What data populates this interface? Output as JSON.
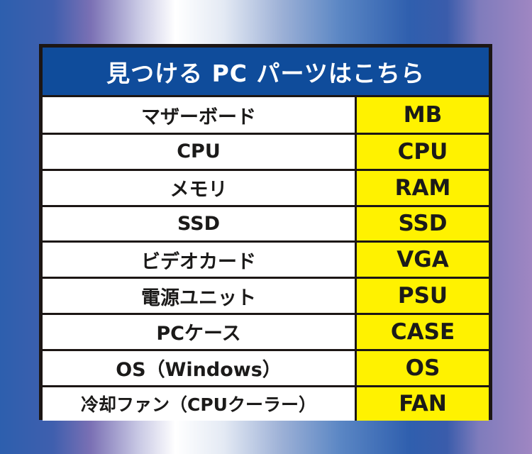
{
  "title": "見つける PC パーツはこちら",
  "colors": {
    "header_bg": "#0f4c9b",
    "abbr_bg": "#fff200",
    "border": "#1c1614"
  },
  "rows": [
    {
      "name": "マザーボード",
      "abbr": "MB"
    },
    {
      "name": "CPU",
      "abbr": "CPU"
    },
    {
      "name": "メモリ",
      "abbr": "RAM"
    },
    {
      "name": "SSD",
      "abbr": "SSD"
    },
    {
      "name": "ビデオカード",
      "abbr": "VGA"
    },
    {
      "name": "電源ユニット",
      "abbr": "PSU"
    },
    {
      "name": "PCケース",
      "abbr": "CASE"
    },
    {
      "name": "OS（Windows）",
      "abbr": "OS"
    },
    {
      "name": "冷却ファン（CPUクーラー）",
      "abbr": "FAN"
    }
  ]
}
